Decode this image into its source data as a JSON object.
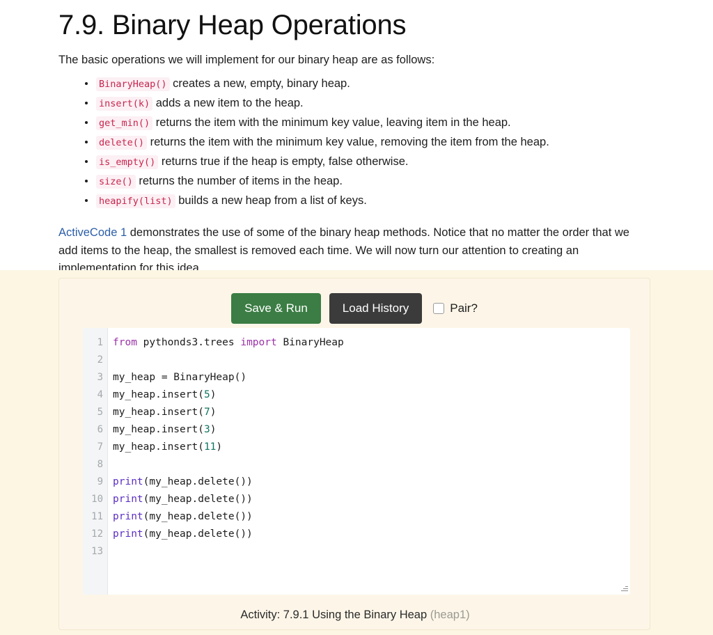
{
  "article": {
    "title": "7.9. Binary Heap Operations",
    "intro": "The basic operations we will implement for our binary heap are as follows:",
    "operations": [
      {
        "code": "BinaryHeap()",
        "desc": "creates a new, empty, binary heap."
      },
      {
        "code": "insert(k)",
        "desc": "adds a new item to the heap."
      },
      {
        "code": "get_min()",
        "desc": "returns the item with the minimum key value, leaving item in the heap."
      },
      {
        "code": "delete()",
        "desc": "returns the item with the minimum key value, removing the item from the heap."
      },
      {
        "code": "is_empty()",
        "desc": "returns true if the heap is empty, false otherwise."
      },
      {
        "code": "size()",
        "desc": "returns the number of items in the heap."
      },
      {
        "code": "heapify(list)",
        "desc": "builds a new heap from a list of keys."
      }
    ],
    "paragraph": {
      "link_text": "ActiveCode 1",
      "rest": " demonstrates the use of some of the binary heap methods. Notice that no matter the order that we add items to the heap, the smallest is removed each time. We will now turn our attention to creating an implementation for this idea."
    }
  },
  "activity": {
    "toolbar": {
      "save_run_label": "Save & Run",
      "load_history_label": "Load History",
      "pair_label": "Pair?",
      "pair_checked": false
    },
    "editor": {
      "line_numbers": [
        "1",
        "2",
        "3",
        "4",
        "5",
        "6",
        "7",
        "8",
        "9",
        "10",
        "11",
        "12",
        "13"
      ],
      "lines": [
        [
          {
            "t": "from ",
            "c": "kw"
          },
          {
            "t": "pythonds3.trees ",
            "c": ""
          },
          {
            "t": "import ",
            "c": "kw"
          },
          {
            "t": "BinaryHeap",
            "c": ""
          }
        ],
        [],
        [
          {
            "t": "my_heap = BinaryHeap()",
            "c": ""
          }
        ],
        [
          {
            "t": "my_heap.insert(",
            "c": ""
          },
          {
            "t": "5",
            "c": "num"
          },
          {
            "t": ")",
            "c": ""
          }
        ],
        [
          {
            "t": "my_heap.insert(",
            "c": ""
          },
          {
            "t": "7",
            "c": "num"
          },
          {
            "t": ")",
            "c": ""
          }
        ],
        [
          {
            "t": "my_heap.insert(",
            "c": ""
          },
          {
            "t": "3",
            "c": "num"
          },
          {
            "t": ")",
            "c": ""
          }
        ],
        [
          {
            "t": "my_heap.insert(",
            "c": ""
          },
          {
            "t": "11",
            "c": "num"
          },
          {
            "t": ")",
            "c": ""
          }
        ],
        [],
        [
          {
            "t": "print",
            "c": "fn"
          },
          {
            "t": "(my_heap.delete())",
            "c": ""
          }
        ],
        [
          {
            "t": "print",
            "c": "fn"
          },
          {
            "t": "(my_heap.delete())",
            "c": ""
          }
        ],
        [
          {
            "t": "print",
            "c": "fn"
          },
          {
            "t": "(my_heap.delete())",
            "c": ""
          }
        ],
        [
          {
            "t": "print",
            "c": "fn"
          },
          {
            "t": "(my_heap.delete())",
            "c": ""
          }
        ],
        []
      ]
    },
    "caption": {
      "text": "Activity: 7.9.1 Using the Binary Heap",
      "id": "(heap1)"
    }
  },
  "colors": {
    "band_background": "#fdf6e3",
    "panel_background": "#fdf6e8",
    "run_button": "#3b7d44",
    "history_button": "#3b3b3b",
    "inline_code_text": "#c7254e",
    "inline_code_background": "#fcf0f4",
    "link": "#2b5ea8",
    "keyword": "#9b32a8",
    "builtin": "#5b2ec4",
    "number": "#0f7560"
  }
}
